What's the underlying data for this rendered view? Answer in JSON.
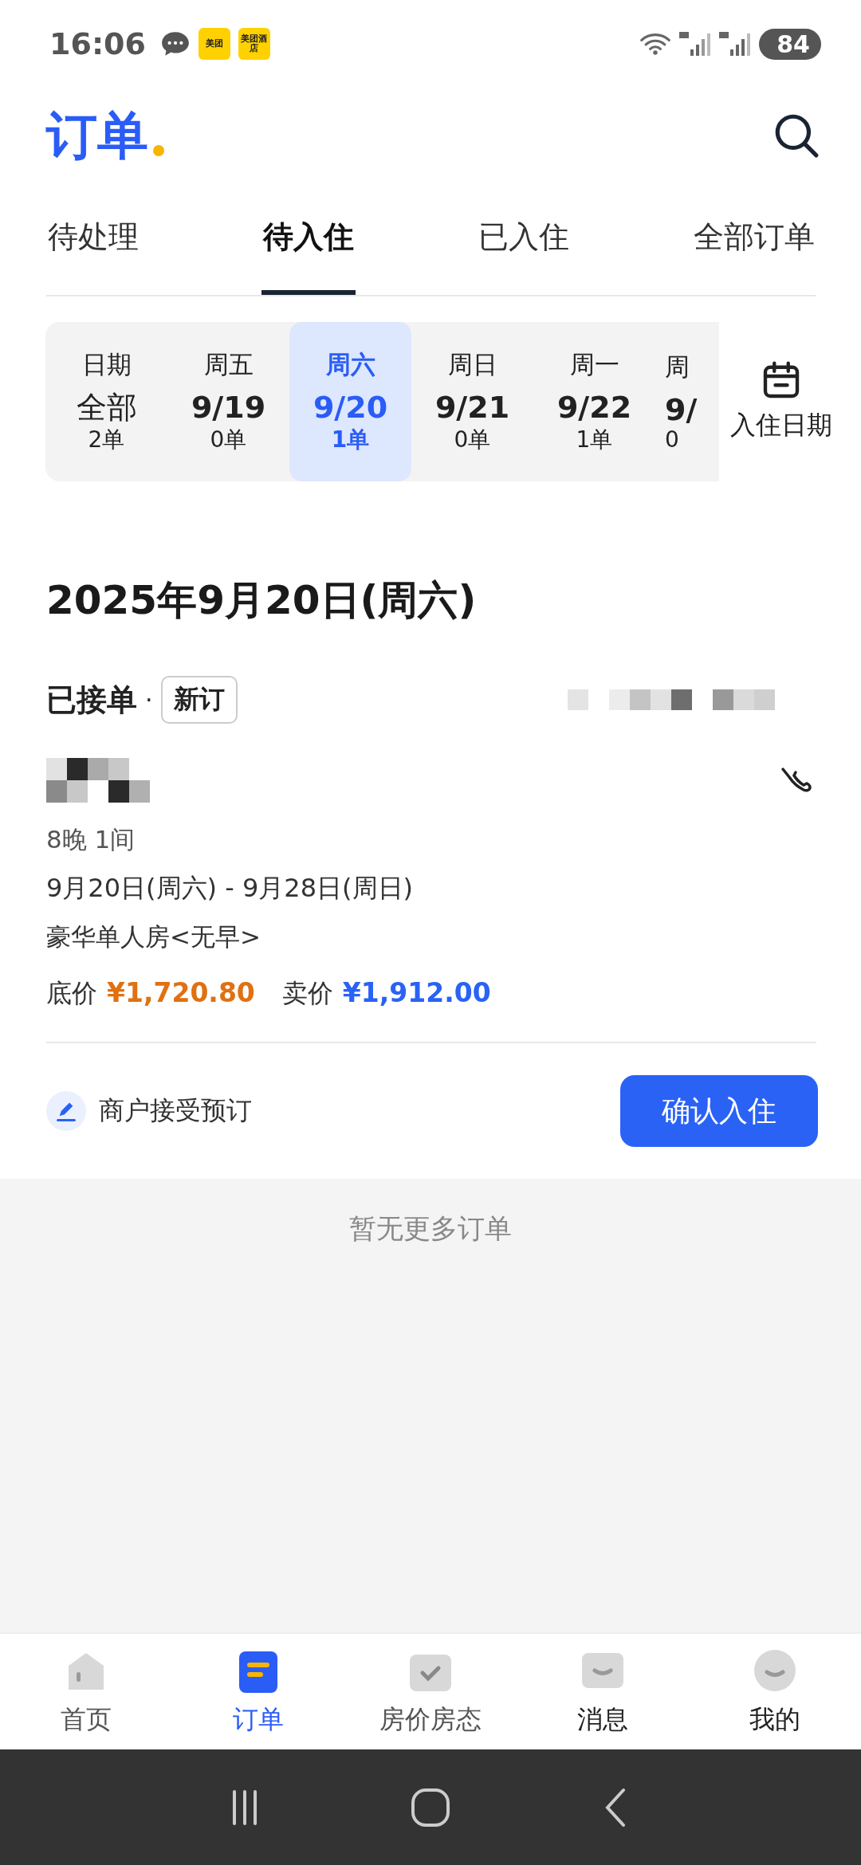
{
  "status_bar": {
    "time": "16:06",
    "notification_icons": [
      {
        "label": "美团"
      },
      {
        "label": "美团酒店"
      }
    ],
    "battery": "84"
  },
  "header": {
    "title": "订单"
  },
  "tabs": [
    {
      "label": "待处理",
      "selected": false
    },
    {
      "label": "待入住",
      "selected": true
    },
    {
      "label": "已入住",
      "selected": false
    },
    {
      "label": "全部订单",
      "selected": false
    }
  ],
  "date_strip": {
    "items": [
      {
        "kind": "all",
        "weekday": "日期",
        "date": "全部",
        "count": "2单",
        "selected": false
      },
      {
        "kind": "day",
        "weekday": "周五",
        "date": "9/19",
        "count": "0单",
        "selected": false
      },
      {
        "kind": "day",
        "weekday": "周六",
        "date": "9/20",
        "count": "1单",
        "selected": true
      },
      {
        "kind": "day",
        "weekday": "周日",
        "date": "9/21",
        "count": "0单",
        "selected": false
      },
      {
        "kind": "day",
        "weekday": "周一",
        "date": "9/22",
        "count": "1单",
        "selected": false
      },
      {
        "kind": "day",
        "weekday": "周",
        "date": "9/",
        "count": "0",
        "selected": false
      }
    ],
    "calendar_button": {
      "label": "入住日期"
    }
  },
  "date_heading": "2025年9月20日(周六)",
  "order": {
    "status": "已接单",
    "separator": "·",
    "tag": "新订",
    "stay": "8晚 1间",
    "dates": "9月20日(周六) - 9月28日(周日)",
    "room": "豪华单人房<无早>",
    "prices": [
      {
        "kind": "base",
        "label": "底价",
        "amount": "¥1,720.80"
      },
      {
        "kind": "sale",
        "label": "卖价",
        "amount": "¥1,912.00"
      }
    ],
    "note": "商户接受预订",
    "action": "确认入住"
  },
  "empty_note": "暂无更多订单",
  "bottom_nav": [
    {
      "kind": "home",
      "label": "首页",
      "selected": false
    },
    {
      "kind": "orders",
      "label": "订单",
      "selected": true
    },
    {
      "kind": "rooms",
      "label": "房价房态",
      "selected": false
    },
    {
      "kind": "messages",
      "label": "消息",
      "selected": false
    },
    {
      "kind": "me",
      "label": "我的",
      "selected": false
    }
  ]
}
